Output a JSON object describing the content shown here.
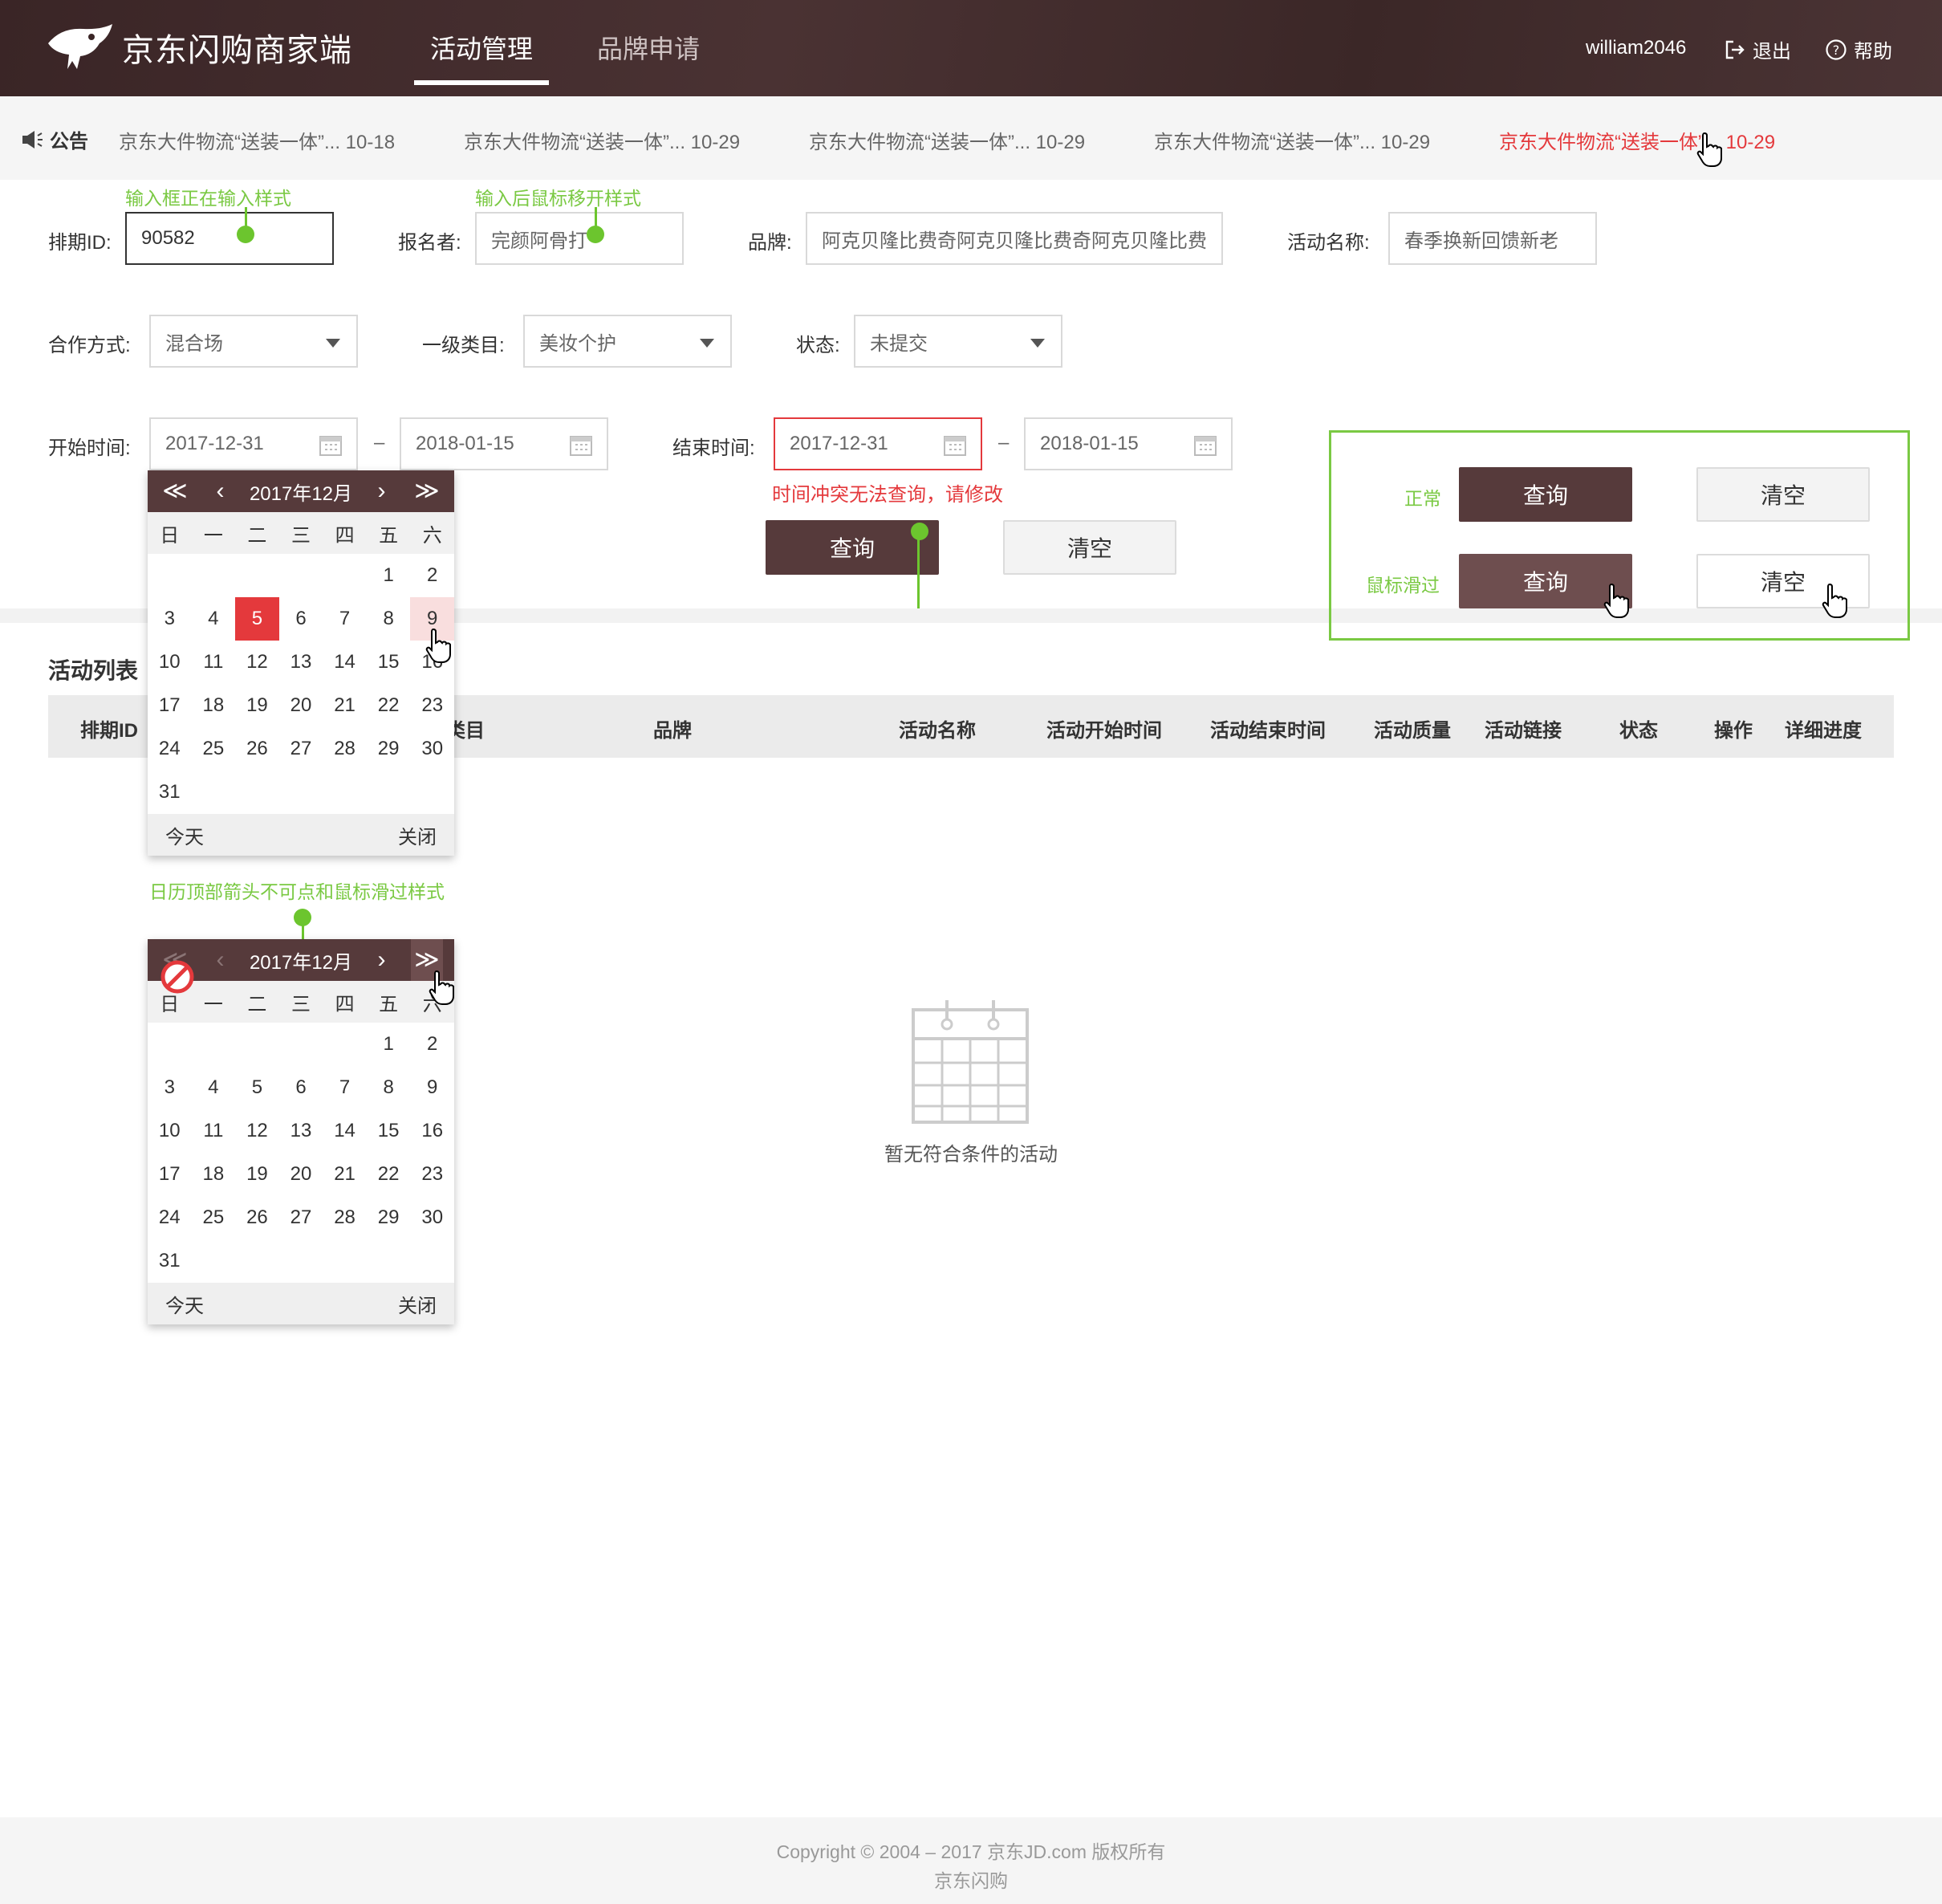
{
  "header": {
    "brand": "京东闪购商家端",
    "nav": [
      "活动管理",
      "品牌申请"
    ],
    "user": "william2046",
    "logout": "退出",
    "help": "帮助"
  },
  "notice": {
    "label": "公告",
    "items": [
      "京东大件物流“送装一体”... 10-18",
      "京东大件物流“送装一体”... 10-29",
      "京东大件物流“送装一体”... 10-29",
      "京东大件物流“送装一体”... 10-29",
      "京东大件物流“送装一体”... 10-29"
    ]
  },
  "notes": {
    "focus_input": "输入框正在输入样式",
    "blur_input": "输入后鼠标移开样式",
    "calendar_arrow": "日历顶部箭头不可点和鼠标滑过样式"
  },
  "form": {
    "id_label": "排期ID:",
    "id_value": "90582",
    "applicant_label": "报名者:",
    "applicant_value": "完颜阿骨打",
    "brand_label": "品牌:",
    "brand_value": "阿克贝隆比费奇阿克贝隆比费奇阿克贝隆比费",
    "activity_label": "活动名称:",
    "activity_value": "春季换新回馈新老",
    "coop_label": "合作方式:",
    "coop_value": "混合场",
    "category_label": "一级类目:",
    "category_value": "美妆个护",
    "status_label": "状态:",
    "status_value": "未提交",
    "start_label": "开始时间:",
    "start_from": "2017-12-31",
    "start_to": "2018-01-15",
    "end_label": "结束时间:",
    "end_from": "2017-12-31",
    "end_to": "2018-01-15",
    "dash": "–",
    "error": "时间冲突无法查询，请修改",
    "query": "查询",
    "clear": "清空"
  },
  "demo": {
    "normal": "正常",
    "hover": "鼠标滑过",
    "query": "查询",
    "clear": "清空"
  },
  "list": {
    "title": "活动列表",
    "columns": [
      "排期ID",
      "类目",
      "品牌",
      "活动名称",
      "活动开始时间",
      "活动结束时间",
      "活动质量",
      "活动链接",
      "状态",
      "操作",
      "详细进度"
    ],
    "empty": "暂无符合条件的活动"
  },
  "calendar": {
    "title": "2017年12月",
    "weekdays": [
      "日",
      "一",
      "二",
      "三",
      "四",
      "五",
      "六"
    ],
    "days": [
      "",
      "",
      "",
      "",
      "",
      "1",
      "2",
      "3",
      "4",
      "5",
      "6",
      "7",
      "8",
      "9",
      "10",
      "11",
      "12",
      "13",
      "14",
      "15",
      "16",
      "17",
      "18",
      "19",
      "20",
      "21",
      "22",
      "23",
      "24",
      "25",
      "26",
      "27",
      "28",
      "29",
      "30",
      "31"
    ],
    "selected": "5",
    "hovered": "9",
    "today": "今天",
    "close": "关闭",
    "first": "≪",
    "prev": "‹",
    "next": "›",
    "last": "≫"
  },
  "footer": {
    "copyright": "Copyright © 2004 – 2017  京东JD.com 版权所有",
    "name": "京东闪购"
  },
  "colors": {
    "header_bg": "#3a2526",
    "primary": "#563a3b",
    "error": "#e4393c",
    "annotation": "#7ac943"
  }
}
